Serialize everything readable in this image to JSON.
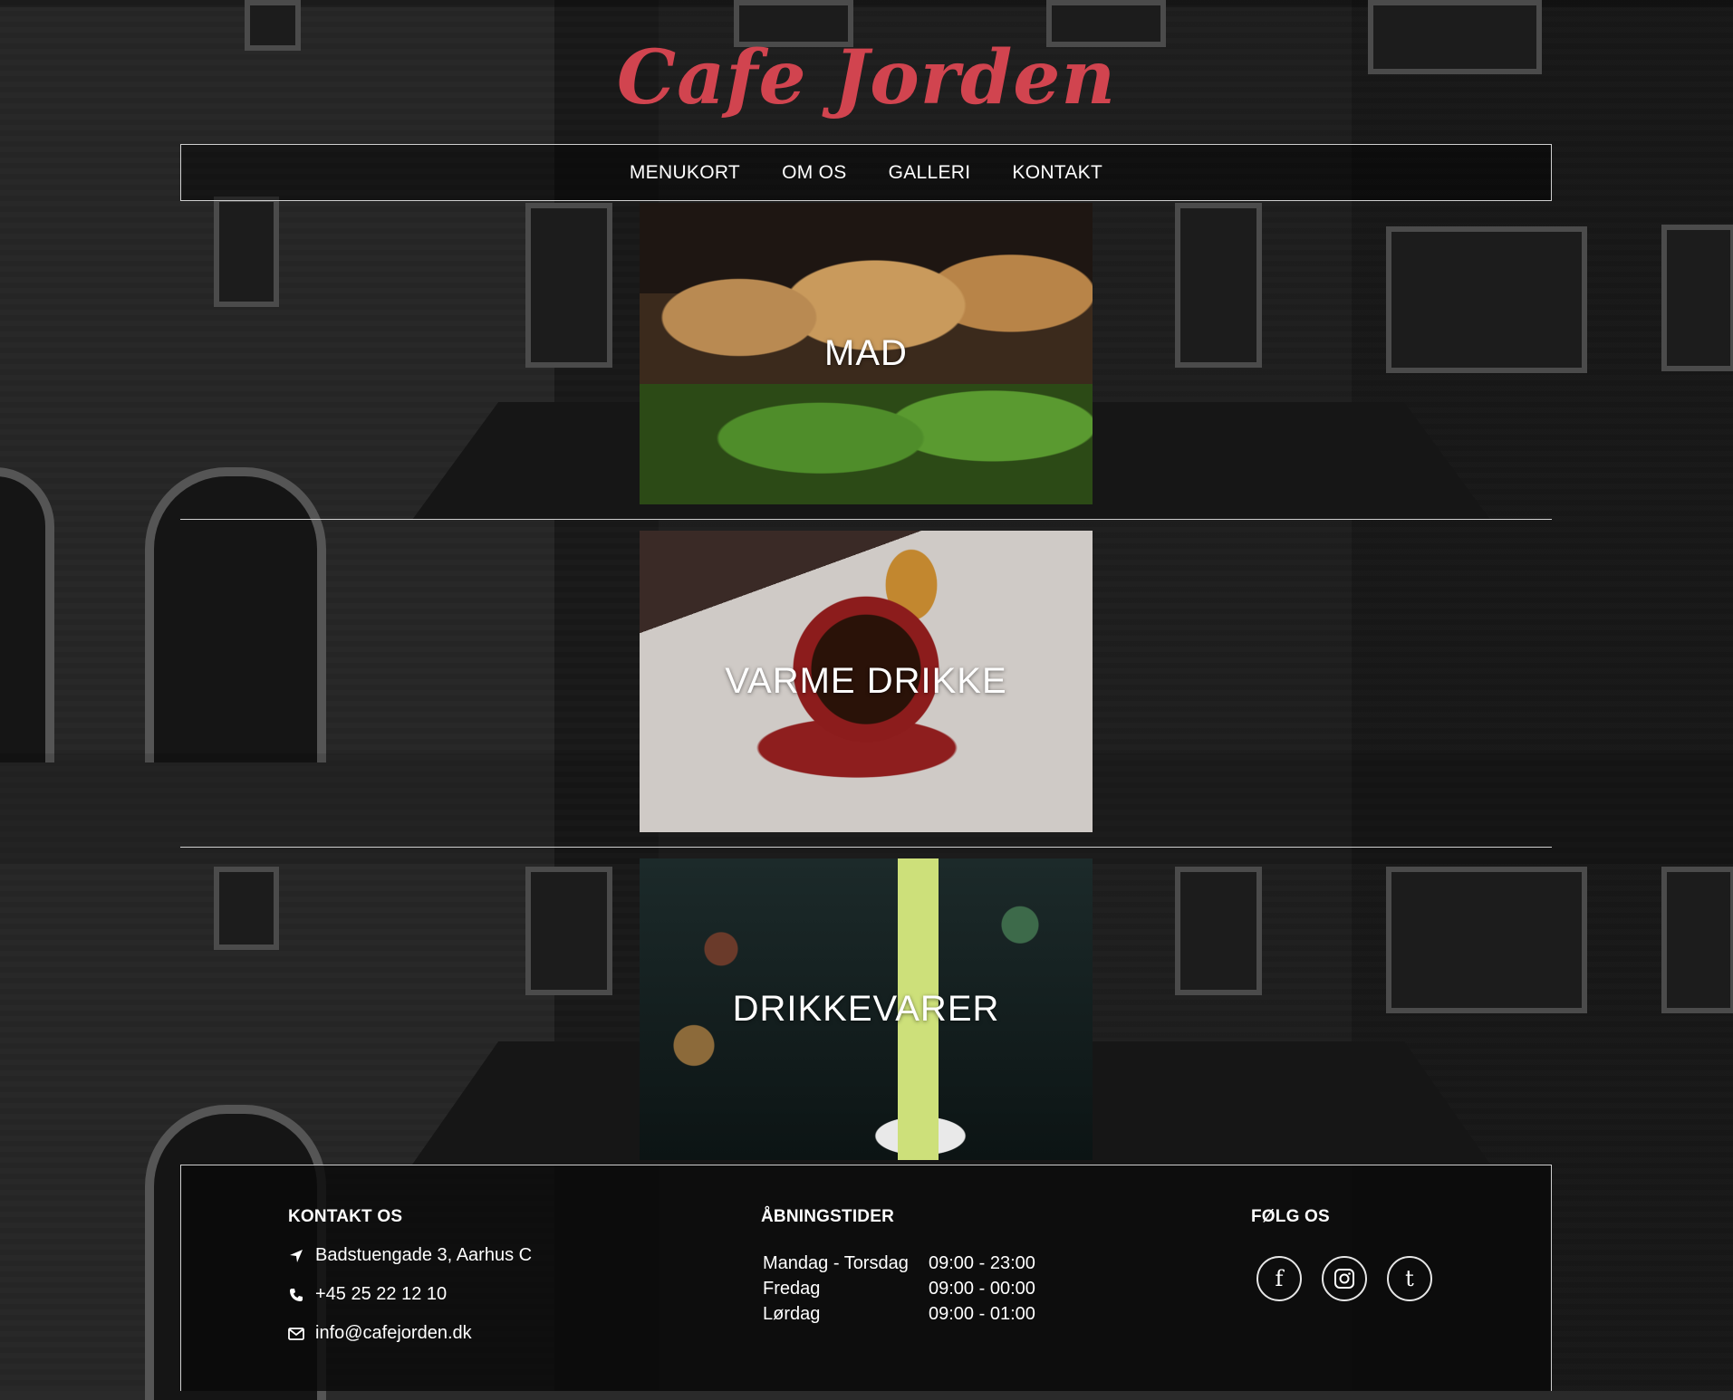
{
  "brand": {
    "logo_text": "Cafe Jorden",
    "accent_color": "#d1444f"
  },
  "nav": {
    "items": [
      "MENUKORT",
      "OM OS",
      "GALLERI",
      "KONTAKT"
    ]
  },
  "categories": [
    {
      "label": "MAD"
    },
    {
      "label": "VARME DRIKKE"
    },
    {
      "label": "DRIKKEVARER"
    }
  ],
  "footer": {
    "contact": {
      "heading": "KONTAKT OS",
      "address": "Badstuengade 3, Aarhus C",
      "phone": "+45 25 22 12 10",
      "email": "info@cafejorden.dk"
    },
    "hours": {
      "heading": "ÅBNINGSTIDER",
      "rows": [
        {
          "day": "Mandag - Torsdag",
          "time": "09:00 - 23:00"
        },
        {
          "day": "Fredag",
          "time": "09:00 - 00:00"
        },
        {
          "day": "Lørdag",
          "time": "09:00 - 01:00"
        }
      ]
    },
    "social": {
      "heading": "FØLG OS",
      "icons": [
        "facebook-icon",
        "instagram-icon",
        "tumblr-icon"
      ]
    }
  }
}
